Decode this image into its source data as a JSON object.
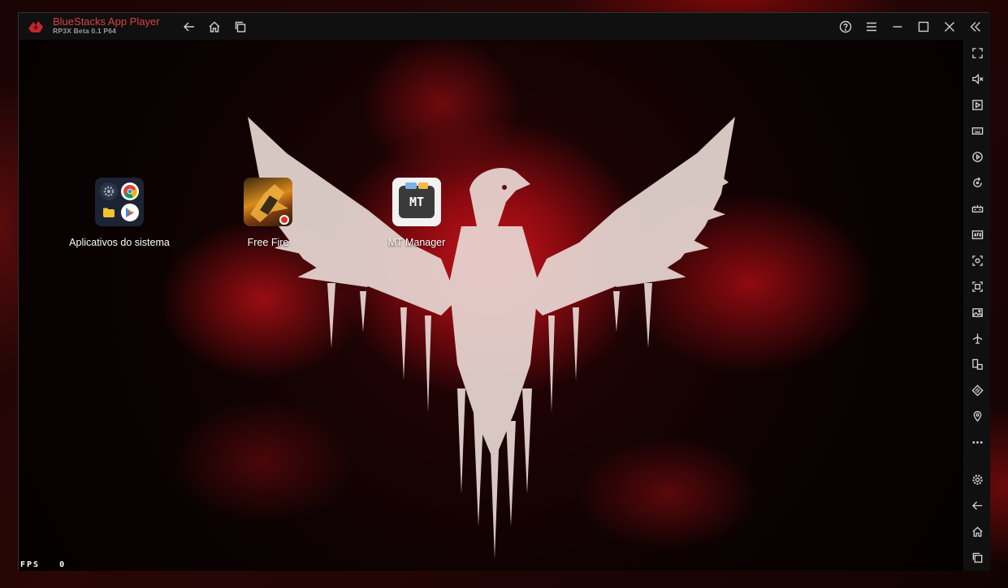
{
  "app": {
    "title": "BlueStacks App Player",
    "subtitle": "RP3X Beta 0.1  P64"
  },
  "titlebar": {
    "buttons": [
      "back-icon",
      "home-icon",
      "recent-apps-icon",
      "help-icon",
      "menu-icon",
      "minimize-icon",
      "maximize-icon",
      "close-icon",
      "collapse-sidebar-icon"
    ]
  },
  "desktop": {
    "apps": [
      {
        "label": "Aplicativos do sistema",
        "icon": "system-apps-folder-icon"
      },
      {
        "label": "Free Fire",
        "icon": "free-fire-icon"
      },
      {
        "label": "MT Manager",
        "icon": "mt-manager-icon",
        "icon_text": "MT"
      }
    ]
  },
  "fps": {
    "label": "FPS",
    "value": "0"
  },
  "sidebar": {
    "tools": [
      "fullscreen-icon",
      "volume-mute-icon",
      "media-manager-icon",
      "keyboard-icon",
      "macro-icon",
      "rotate-icon",
      "game-controls-icon",
      "apk-install-icon",
      "screenshot-icon",
      "record-icon",
      "gallery-icon",
      "airplane-icon",
      "multi-instance-icon",
      "eco-mode-icon",
      "location-icon",
      "more-icon",
      "settings-icon",
      "back-icon",
      "home-icon",
      "recent-apps-icon"
    ]
  },
  "colors": {
    "titlebar": "#101010",
    "title_accent": "#d9433a",
    "wallpaper_red": "#c8141a"
  }
}
